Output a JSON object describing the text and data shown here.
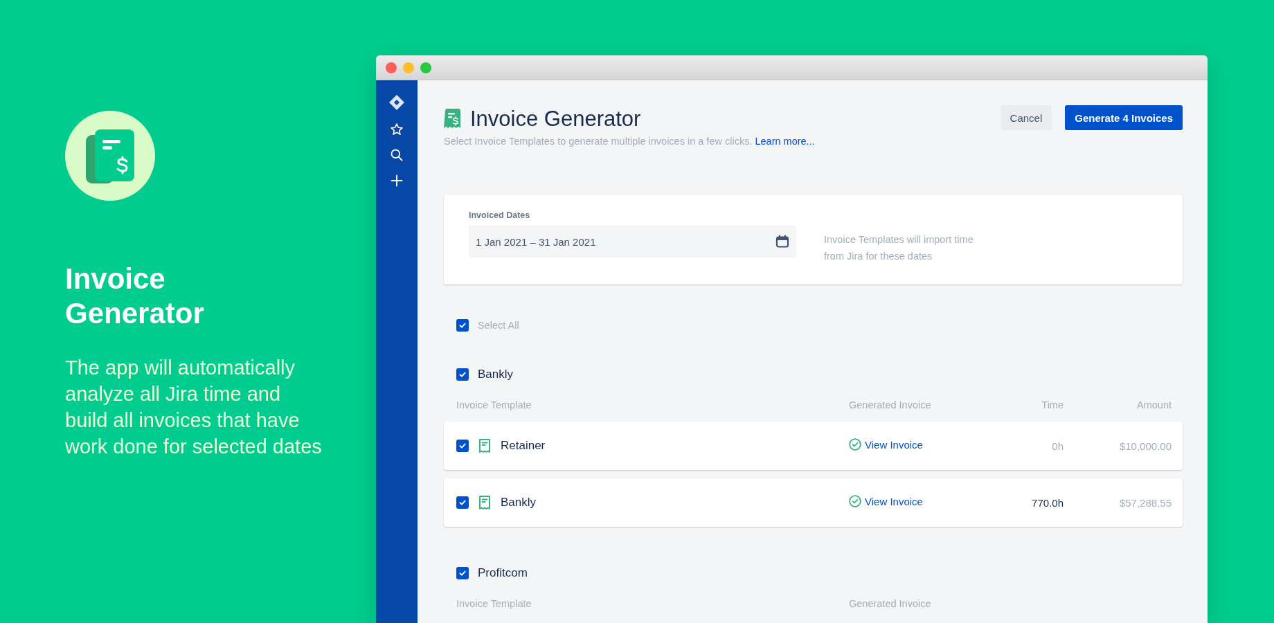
{
  "promo": {
    "title": "Invoice Generator",
    "description": "The app will automatically analyze all Jira time and build all invoices that have work done for selected dates"
  },
  "header": {
    "title": "Invoice Generator",
    "subtitle": "Select Invoice Templates to generate multiple invoices in a few clicks.",
    "link": "Learn more...",
    "buttons": [
      {
        "label": "Cancel",
        "kind": "secondary"
      },
      {
        "label": "Generate 4 Invoices",
        "kind": "primary"
      }
    ]
  },
  "dates": {
    "label": "Invoiced Dates",
    "value": "1 Jan 2021 – 31 Jan 2021",
    "hint": "Invoice Templates will import time from Jira for these dates"
  },
  "select_all": {
    "label": "Select All",
    "checked": true
  },
  "groups": [
    {
      "name": "Bankly",
      "checked": true,
      "columns": [
        "Invoice Template",
        "Generated Invoice",
        "Time",
        "Amount"
      ],
      "rows": [
        {
          "name": "Retainer",
          "checked": true,
          "invoice": "View Invoice",
          "time": "0h",
          "time_muted": true,
          "amount": "$10,000.00"
        },
        {
          "name": "Bankly",
          "checked": true,
          "invoice": "View Invoice",
          "time": "770.0h",
          "time_muted": false,
          "amount": "$57,288.55"
        }
      ]
    },
    {
      "name": "Profitcom",
      "checked": true,
      "columns": [
        "Invoice Template",
        "Generated Invoice"
      ]
    }
  ]
}
